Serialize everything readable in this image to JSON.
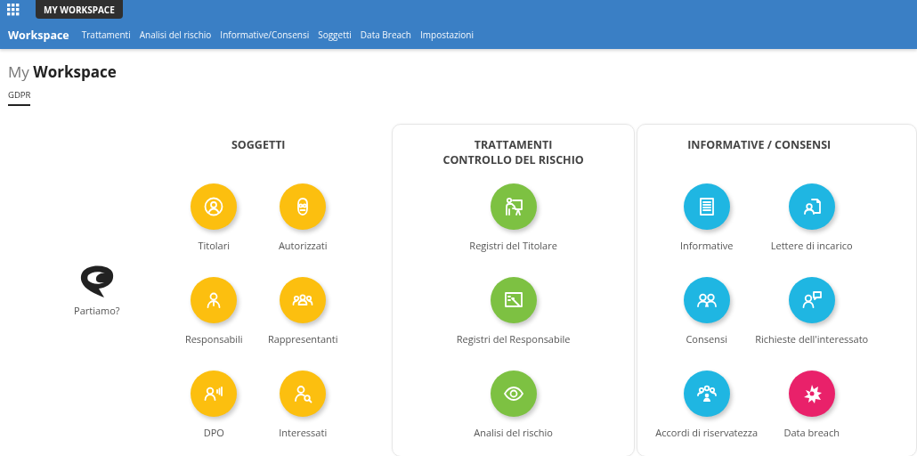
{
  "top_bar": {
    "app_button": "MY WORKSPACE"
  },
  "nav": {
    "brand": "Workspace",
    "links": [
      {
        "label": "Trattamenti"
      },
      {
        "label": "Analisi del rischio"
      },
      {
        "label": "Informative/Consensi"
      },
      {
        "label": "Soggetti"
      },
      {
        "label": "Data Breach"
      },
      {
        "label": "Impostazioni"
      }
    ]
  },
  "page": {
    "title": "My **Workspace**",
    "tabs": [
      {
        "label": "GDPR",
        "selected": true
      }
    ]
  },
  "start": {
    "label": "Partiamo?"
  },
  "sections": [
    {
      "title": "SOGGETTI",
      "card": false,
      "tiles": [
        {
          "label": "Titolari",
          "color": "#fcbf0f"
        },
        {
          "label": "Autorizzati",
          "color": "#fcbf0f"
        },
        {
          "label": "Responsabili",
          "color": "#fcbf0f"
        },
        {
          "label": "Rappresentanti",
          "color": "#fcbf0f"
        },
        {
          "label": "DPO",
          "color": "#fcbf0f"
        },
        {
          "label": "Interessati",
          "color": "#fcbf0f"
        }
      ]
    },
    {
      "title": "TRATTAMENTI\nCONTROLLO DEL RISCHIO",
      "card": true,
      "tiles": [
        {
          "label": "Registri del Titolare",
          "color": "#7dc142"
        },
        {
          "label": "Registri del Responsabile",
          "color": "#7dc142"
        },
        {
          "label": "Analisi del rischio",
          "color": "#7dc142"
        }
      ]
    },
    {
      "title": "INFORMATIVE / CONSENSI",
      "card": true,
      "tiles": [
        {
          "label": "Informative",
          "color": "#1fb6e2"
        },
        {
          "label": "Lettere di incarico",
          "color": "#1fb6e2"
        },
        {
          "label": "Consensi",
          "color": "#1fb6e2"
        },
        {
          "label": "Richieste dell'interessato",
          "color": "#1fb6e2"
        },
        {
          "label": "Accordi di riservatezza",
          "color": "#1fb6e2"
        },
        {
          "label": "Data breach",
          "color": "#e9216a"
        }
      ]
    }
  ]
}
